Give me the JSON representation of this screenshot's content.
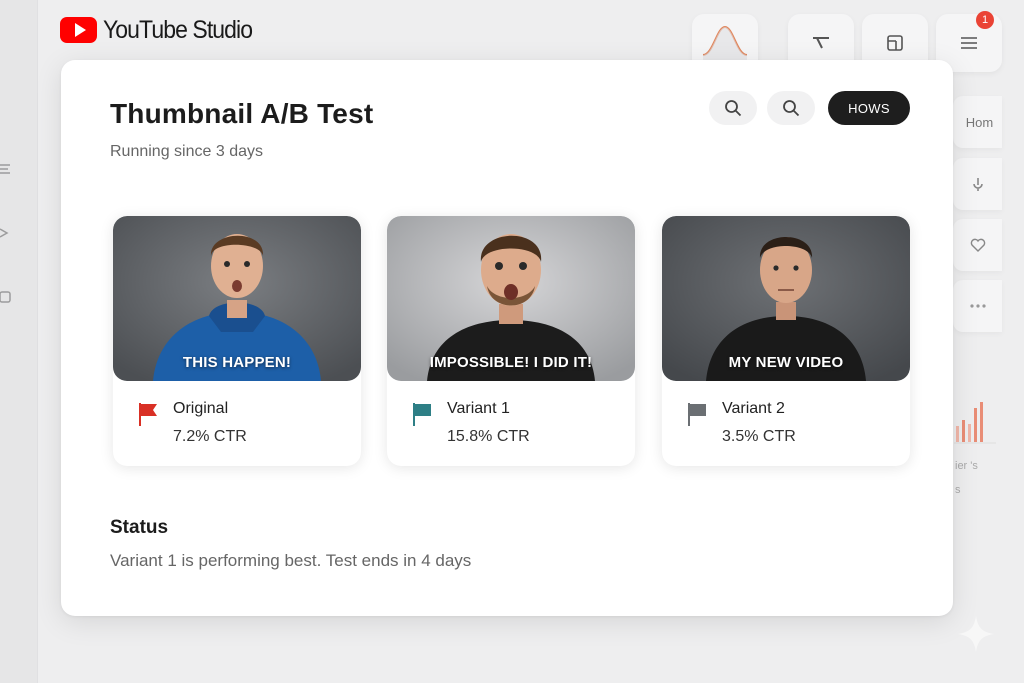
{
  "app": {
    "brand_name": "YouTube Studio",
    "brand_color": "#ff0000"
  },
  "top_toolbar": {
    "items": [
      {
        "icon": "analytics-wave-icon"
      },
      {
        "icon": "filter-icon"
      },
      {
        "icon": "layout-icon"
      },
      {
        "icon": "list-icon",
        "badge": "1"
      }
    ]
  },
  "right_panel": {
    "home_label": "Hom",
    "faded_label_1": "ier 's",
    "faded_label_2": "s"
  },
  "test": {
    "title": "Thumbnail A/B Test",
    "subtitle": "Running since 3 days",
    "actions": {
      "search_1_icon": "search-icon",
      "search_2_icon": "search-icon",
      "shows_label": "HOWS"
    },
    "variants": [
      {
        "name": "Original",
        "ctr": "7.2% CTR",
        "caption": "THIS HAPPEN!",
        "flag_color": "#d93025"
      },
      {
        "name": "Variant 1",
        "ctr": "15.8% CTR",
        "caption": "IMPOSSIBLE! I DID IT!",
        "flag_color": "#2e7f86"
      },
      {
        "name": "Variant 2",
        "ctr": "3.5% CTR",
        "caption": "MY NEW VIDEO",
        "flag_color": "#6b6f73"
      }
    ],
    "status": {
      "heading": "Status",
      "text": "Variant 1 is performing best. Test ends in 4 days"
    }
  }
}
